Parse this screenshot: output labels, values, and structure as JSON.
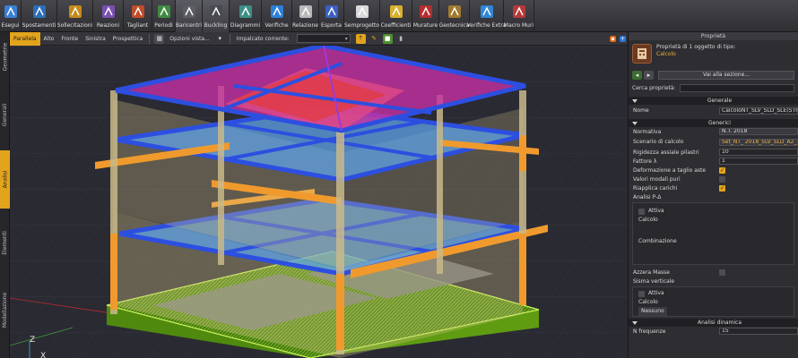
{
  "ribbon": {
    "tools": [
      {
        "label": "Esegui",
        "icon": "run-icon"
      },
      {
        "label": "Spostamenti",
        "icon": "move-icon"
      },
      {
        "label": "Sollecitazioni",
        "icon": "stress-icon"
      },
      {
        "label": "Reazioni",
        "icon": "reactions-icon"
      },
      {
        "label": "Tagliant",
        "icon": "shear-icon"
      },
      {
        "label": "Periodi",
        "icon": "periods-icon"
      },
      {
        "label": "Baricentri",
        "icon": "centroid-icon"
      },
      {
        "label": "Buckling",
        "icon": "buckling-icon"
      },
      {
        "label": "Diagrammi",
        "icon": "diagram-icon"
      },
      {
        "label": "Verifiche",
        "icon": "verify-icon"
      },
      {
        "label": "Relazione",
        "icon": "report-icon"
      },
      {
        "label": "Esporta",
        "icon": "export-icon"
      },
      {
        "label": "Semprogetto",
        "icon": "design-icon"
      },
      {
        "label": "Coefficienti",
        "icon": "coefficients-icon"
      },
      {
        "label": "Murature",
        "icon": "masonry-icon"
      },
      {
        "label": "Geotecnica",
        "icon": "geotechnics-icon"
      },
      {
        "label": "Verifiche Extra",
        "icon": "extra-verify-icon"
      },
      {
        "label": "Macro Muri",
        "icon": "macro-walls-icon"
      }
    ]
  },
  "sidetabs": [
    "Geometrie",
    "Generali",
    "Analisi",
    "Elementi",
    "Modellazione"
  ],
  "viewtoolbar": {
    "views": [
      "Parallela",
      "Alto",
      "Fronte",
      "Sinistra",
      "Prospettica"
    ],
    "options_label": "Opzioni vista...",
    "plane_label": "Impalcato corrente:"
  },
  "viewport": {
    "axis_z": "Z",
    "axis_x": "X"
  },
  "colors": {
    "accent": "#e2a41d",
    "roof": "#c62fa3",
    "beams": "#2d4fe0",
    "columns_yellow": "#f09a2d",
    "foundation": "#79c61c"
  },
  "props": {
    "title": "Proprietà",
    "header_line1": "Proprietà di 1 oggetto di tipo:",
    "header_line2": "Calcolo",
    "goto_section": "Vai alla sezione...",
    "search_label": "Cerca proprietà:",
    "sec_generale": "Generale",
    "name_key": "Nome",
    "name_val": "CalcoloNT_SLV_SLD_SLE(STR/GEO)",
    "sec_generici": "Generici",
    "rows": [
      {
        "k": "Normativa",
        "v": "N.T. 2018"
      },
      {
        "k": "Scenario di calcolo",
        "v": "Set_NT_ 2018_SLV_SLD_A2_..."
      },
      {
        "k": "Rigidezza assiale pilastri",
        "v": "10"
      },
      {
        "k": "Fattore λ",
        "v": "1"
      }
    ],
    "checks": [
      {
        "k": "Deformazione a taglio aste",
        "on": true
      },
      {
        "k": "Valori modali puri",
        "on": false
      },
      {
        "k": "Riapplica carichi",
        "on": true
      }
    ],
    "pdelta_label": "Analisi P-Δ",
    "attiva_label": "Attiva",
    "calcolo_label": "Calcolo",
    "combinazione_label": "Combinazione",
    "azzera_label": "Azzera Masse",
    "sisma_label": "Sisma verticale",
    "attiva2_label": "Attiva",
    "calcolo2_label": "Calcolo",
    "nessuno_label": "Nessuno",
    "sec_dinamica": "Analisi dinamica",
    "freq_key": "N frequenze",
    "freq_val": "15"
  }
}
